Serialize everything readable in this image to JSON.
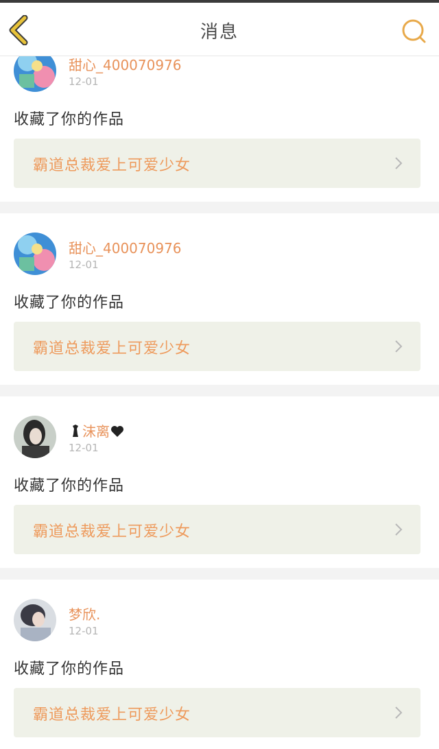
{
  "header": {
    "title": "消息",
    "back_icon": "chevron-left-icon",
    "search_icon": "search-icon"
  },
  "colors": {
    "accent": "#e8a94a",
    "username": "#e8925a",
    "work_title": "#ee9a5c",
    "link_bg": "#eff1e8"
  },
  "messages": [
    {
      "username": "甜心_400070976",
      "date": "12-01",
      "action": "收藏了你的作品",
      "work": "霸道总裁爱上可爱少女"
    },
    {
      "username": "甜心_400070976",
      "date": "12-01",
      "action": "收藏了你的作品",
      "work": "霸道总裁爱上可爱少女"
    },
    {
      "username": "沫离",
      "date": "12-01",
      "action": "收藏了你的作品",
      "work": "霸道总裁爱上可爱少女"
    },
    {
      "username": "梦欣.",
      "date": "12-01",
      "action": "收藏了你的作品",
      "work": "霸道总裁爱上可爱少女"
    }
  ]
}
